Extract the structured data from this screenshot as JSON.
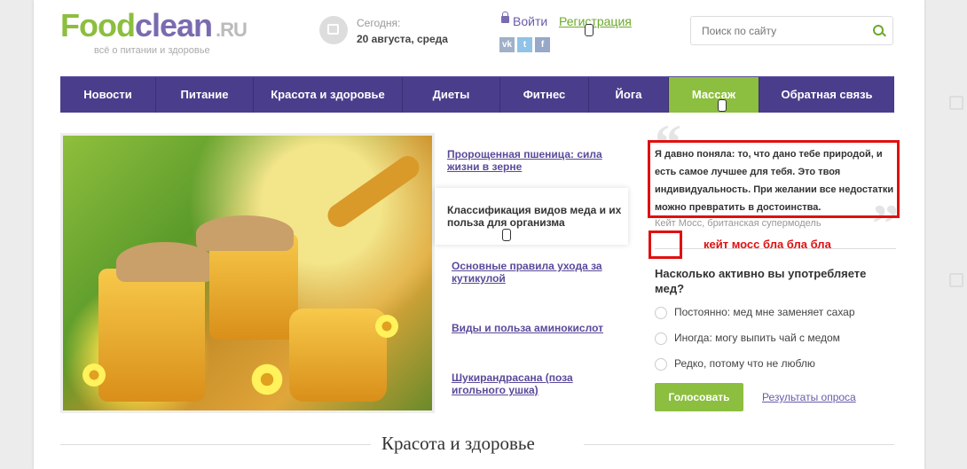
{
  "header": {
    "logo_part1": "Food",
    "logo_part2": "clean",
    "logo_domain": ".RU",
    "tagline": "всё о питании и здоровье",
    "today_label": "Сегодня:",
    "today_date": "20 августа, среда",
    "login_label": "Войти",
    "register_label": "Регистрация",
    "social": [
      {
        "icon": "vk-icon",
        "text": "vk",
        "color": "#9fb0c8"
      },
      {
        "icon": "twitter-icon",
        "text": "t",
        "color": "#8fc3e8"
      },
      {
        "icon": "facebook-icon",
        "text": "f",
        "color": "#97a8c8"
      }
    ],
    "search_placeholder": "Поиск по сайту"
  },
  "nav": {
    "items": [
      "Новости",
      "Питание",
      "Красота и здоровье",
      "Диеты",
      "Фитнес",
      "Йога",
      "Массаж",
      "Обратная связь"
    ],
    "active_index": 6
  },
  "articles": {
    "items": [
      "Пророщенная пшеница: сила жизни в зерне",
      "Классификация видов меда и их польза для организма",
      "Основные правила ухода за кутикулой",
      "Виды и польза аминокислот",
      "Шукирандрасана (поза игольного ушка)"
    ],
    "active_index": 1
  },
  "quote": {
    "text": "Я давно поняла: то, что дано тебе природой, и есть самое лучшее для тебя. Это твоя индивидуальность. При желании все недостатки можно превратить в достоинства.",
    "author": "Кейт Мосс, британская супермодель"
  },
  "annotation": "кейт мосс бла бла бла",
  "poll": {
    "question": "Насколько активно вы употребляете мед?",
    "options": [
      "Постоянно: мед мне заменяет сахар",
      "Иногда: могу выпить чай с медом",
      "Редко, потому что не люблю"
    ],
    "vote_label": "Голосовать",
    "results_label": "Результаты опроса"
  },
  "section_title": "Красота и здоровье",
  "colors": {
    "green": "#8cbe3f",
    "purple": "#4a3e8c",
    "annotation_red": "#e01010"
  }
}
